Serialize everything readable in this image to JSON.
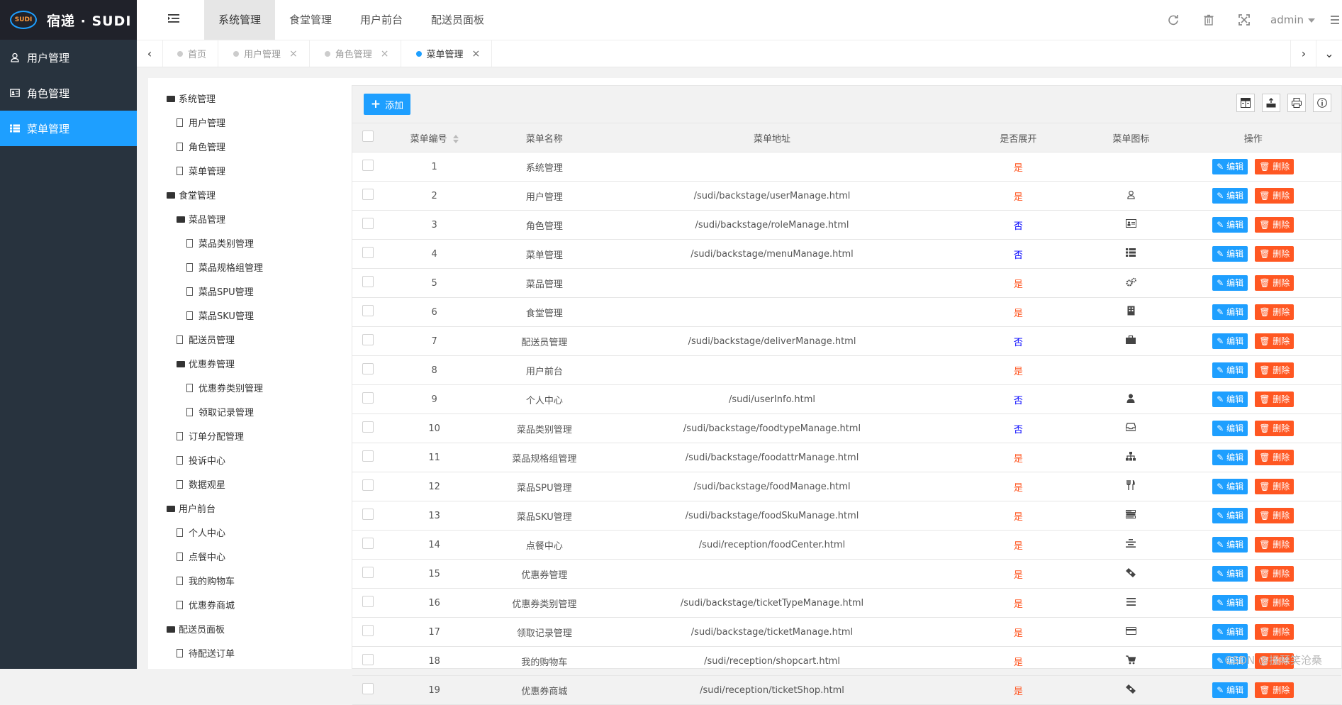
{
  "logo": {
    "badge": "SUDI",
    "text": "宿递 · SUDI"
  },
  "sidebar": {
    "items": [
      {
        "label": "用户管理"
      },
      {
        "label": "角色管理"
      },
      {
        "label": "菜单管理"
      }
    ]
  },
  "topnav": {
    "items": [
      {
        "label": "系统管理"
      },
      {
        "label": "食堂管理"
      },
      {
        "label": "用户前台"
      },
      {
        "label": "配送员面板"
      }
    ]
  },
  "header": {
    "user": "admin"
  },
  "tabs": [
    {
      "label": "首页"
    },
    {
      "label": "用户管理"
    },
    {
      "label": "角色管理"
    },
    {
      "label": "菜单管理"
    }
  ],
  "tree": [
    {
      "label": "系统管理"
    },
    {
      "label": "用户管理"
    },
    {
      "label": "角色管理"
    },
    {
      "label": "菜单管理"
    },
    {
      "label": "食堂管理"
    },
    {
      "label": "菜品管理"
    },
    {
      "label": "菜品类别管理"
    },
    {
      "label": "菜品规格组管理"
    },
    {
      "label": "菜品SPU管理"
    },
    {
      "label": "菜品SKU管理"
    },
    {
      "label": "配送员管理"
    },
    {
      "label": "优惠券管理"
    },
    {
      "label": "优惠券类别管理"
    },
    {
      "label": "领取记录管理"
    },
    {
      "label": "订单分配管理"
    },
    {
      "label": "投诉中心"
    },
    {
      "label": "数据观星"
    },
    {
      "label": "用户前台"
    },
    {
      "label": "个人中心"
    },
    {
      "label": "点餐中心"
    },
    {
      "label": "我的购物车"
    },
    {
      "label": "优惠券商城"
    },
    {
      "label": "配送员面板"
    },
    {
      "label": "待配送订单"
    }
  ],
  "toolbar": {
    "add_label": "添加"
  },
  "table": {
    "headers": {
      "id": "菜单编号",
      "name": "菜单名称",
      "url": "菜单地址",
      "expand": "是否展开",
      "icon": "菜单图标",
      "action": "操作"
    },
    "edit_label": "编辑",
    "delete_label": "删除",
    "rows": [
      {
        "id": "1",
        "name": "系统管理",
        "url": "",
        "expand": "是",
        "icon": ""
      },
      {
        "id": "2",
        "name": "用户管理",
        "url": "/sudi/backstage/userManage.html",
        "expand": "是",
        "icon": "user-icon"
      },
      {
        "id": "3",
        "name": "角色管理",
        "url": "/sudi/backstage/roleManage.html",
        "expand": "否",
        "icon": "id-card-icon"
      },
      {
        "id": "4",
        "name": "菜单管理",
        "url": "/sudi/backstage/menuManage.html",
        "expand": "否",
        "icon": "list-icon"
      },
      {
        "id": "5",
        "name": "菜品管理",
        "url": "",
        "expand": "是",
        "icon": "gears-icon"
      },
      {
        "id": "6",
        "name": "食堂管理",
        "url": "",
        "expand": "是",
        "icon": "building-icon"
      },
      {
        "id": "7",
        "name": "配送员管理",
        "url": "/sudi/backstage/deliverManage.html",
        "expand": "否",
        "icon": "briefcase-icon"
      },
      {
        "id": "8",
        "name": "用户前台",
        "url": "",
        "expand": "是",
        "icon": ""
      },
      {
        "id": "9",
        "name": "个人中心",
        "url": "/sudi/userInfo.html",
        "expand": "否",
        "icon": "person-icon"
      },
      {
        "id": "10",
        "name": "菜品类别管理",
        "url": "/sudi/backstage/foodtypeManage.html",
        "expand": "否",
        "icon": "inbox-icon"
      },
      {
        "id": "11",
        "name": "菜品规格组管理",
        "url": "/sudi/backstage/foodattrManage.html",
        "expand": "是",
        "icon": "sitemap-icon"
      },
      {
        "id": "12",
        "name": "菜品SPU管理",
        "url": "/sudi/backstage/foodManage.html",
        "expand": "是",
        "icon": "cutlery-icon"
      },
      {
        "id": "13",
        "name": "菜品SKU管理",
        "url": "/sudi/backstage/foodSkuManage.html",
        "expand": "是",
        "icon": "tasks-icon"
      },
      {
        "id": "14",
        "name": "点餐中心",
        "url": "/sudi/reception/foodCenter.html",
        "expand": "是",
        "icon": "align-center-icon"
      },
      {
        "id": "15",
        "name": "优惠券管理",
        "url": "",
        "expand": "是",
        "icon": "ticket-icon"
      },
      {
        "id": "16",
        "name": "优惠券类别管理",
        "url": "/sudi/backstage/ticketTypeManage.html",
        "expand": "是",
        "icon": "bars-icon"
      },
      {
        "id": "17",
        "name": "领取记录管理",
        "url": "/sudi/backstage/ticketManage.html",
        "expand": "是",
        "icon": "credit-card-icon"
      },
      {
        "id": "18",
        "name": "我的购物车",
        "url": "/sudi/reception/shopcart.html",
        "expand": "是",
        "icon": "cart-icon"
      },
      {
        "id": "19",
        "name": "优惠券商城",
        "url": "/sudi/reception/ticketShop.html",
        "expand": "是",
        "icon": "ticket-icon"
      }
    ]
  },
  "watermark": "CSDN @抚琴笑沧桑",
  "colors": {
    "accent": "#1e9fff",
    "danger": "#ff5722",
    "sidebar": "#28333e",
    "no": "#0000ff"
  }
}
